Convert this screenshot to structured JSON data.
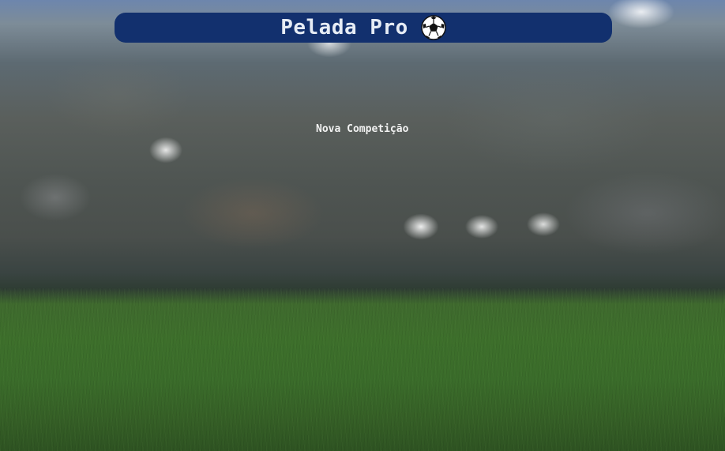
{
  "header": {
    "title": "Pelada Pro",
    "icon": "soccer-ball-icon",
    "background_color": "#12306e",
    "title_color": "#e6ecf5"
  },
  "main": {
    "new_competition_label": "Nova Competição"
  }
}
